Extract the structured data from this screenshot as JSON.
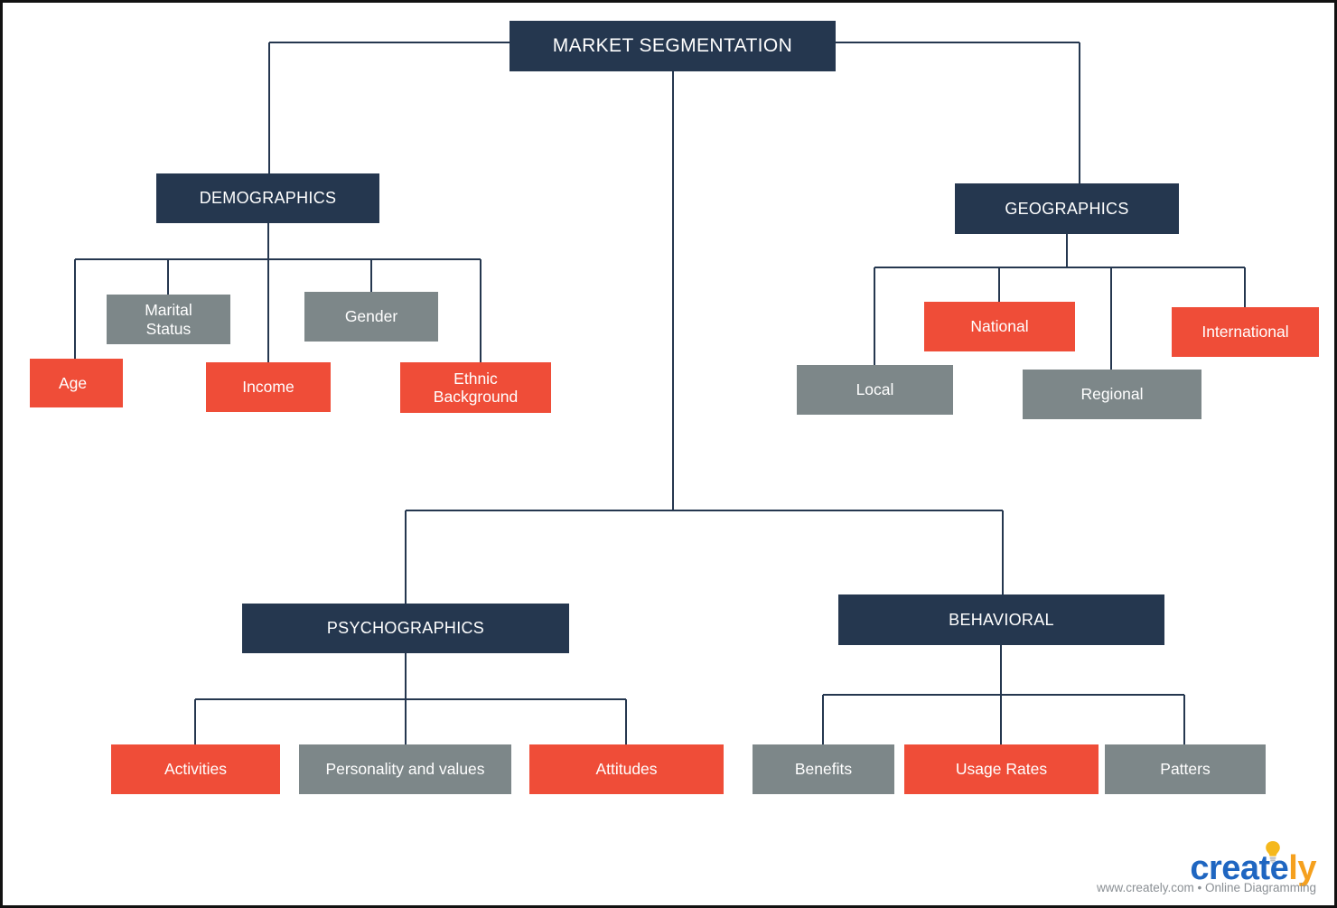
{
  "theme": {
    "navy": "#25374f",
    "red": "#ef4d38",
    "gray": "#7d8789",
    "line": "#25374f",
    "background": "#ffffff",
    "text": "#ffffff"
  },
  "diagram": {
    "type": "tree",
    "root": {
      "label": "MARKET SEGMENTATION",
      "color": "navy"
    },
    "branches": [
      {
        "label": "DEMOGRAPHICS",
        "color": "navy",
        "children": [
          {
            "label": "Age",
            "color": "red"
          },
          {
            "label": "Marital\nStatus",
            "color": "gray"
          },
          {
            "label": "Income",
            "color": "red"
          },
          {
            "label": "Gender",
            "color": "gray"
          },
          {
            "label": "Ethnic\nBackground",
            "color": "red"
          }
        ]
      },
      {
        "label": "GEOGRAPHICS",
        "color": "navy",
        "children": [
          {
            "label": "Local",
            "color": "gray"
          },
          {
            "label": "National",
            "color": "red"
          },
          {
            "label": "Regional",
            "color": "gray"
          },
          {
            "label": "International",
            "color": "red"
          }
        ]
      },
      {
        "label": "PSYCHOGRAPHICS",
        "color": "navy",
        "children": [
          {
            "label": "Activities",
            "color": "red"
          },
          {
            "label": "Personality and values",
            "color": "gray"
          },
          {
            "label": "Attitudes",
            "color": "red"
          }
        ]
      },
      {
        "label": "BEHAVIORAL",
        "color": "navy",
        "children": [
          {
            "label": "Benefits",
            "color": "gray"
          },
          {
            "label": "Usage Rates",
            "color": "red"
          },
          {
            "label": "Patters",
            "color": "gray"
          }
        ]
      }
    ]
  },
  "nodes": {
    "root": {
      "label": "MARKET SEGMENTATION"
    },
    "demographics": {
      "label": "DEMOGRAPHICS"
    },
    "geographics": {
      "label": "GEOGRAPHICS"
    },
    "psychographics": {
      "label": "PSYCHOGRAPHICS"
    },
    "behavioral": {
      "label": "BEHAVIORAL"
    },
    "age": {
      "label": "Age"
    },
    "marital_status": {
      "label": "Marital\nStatus"
    },
    "income": {
      "label": "Income"
    },
    "gender": {
      "label": "Gender"
    },
    "ethnic_background": {
      "label": "Ethnic\nBackground"
    },
    "local": {
      "label": "Local"
    },
    "national": {
      "label": "National"
    },
    "regional": {
      "label": "Regional"
    },
    "international": {
      "label": "International"
    },
    "activities": {
      "label": "Activities"
    },
    "personality": {
      "label": "Personality and values"
    },
    "attitudes": {
      "label": "Attitudes"
    },
    "benefits": {
      "label": "Benefits"
    },
    "usage_rates": {
      "label": "Usage Rates"
    },
    "patters": {
      "label": "Patters"
    }
  },
  "footer": {
    "brand_part1": "creat",
    "brand_part2": "e",
    "brand_part3": "ly",
    "tagline": "www.creately.com • Online Diagramming",
    "bulb_icon": "lightbulb-icon",
    "brand_blue": "#1f66c1",
    "brand_orange": "#f5a01e"
  }
}
